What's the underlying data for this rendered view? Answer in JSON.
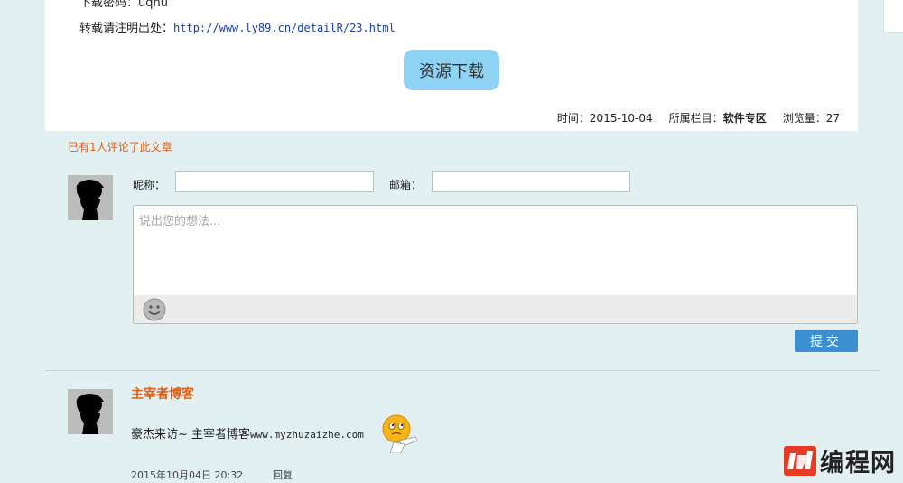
{
  "article": {
    "top_line": "下载密码：uqhu",
    "source_label": "转载请注明出处：",
    "source_url": "http://www.ly89.cn/detailR/23.html",
    "download_button": "资源下载",
    "meta": {
      "time_label": "时间：",
      "time_value": "2015-10-04",
      "category_label": "所属栏目：",
      "category_value": "软件专区",
      "views_label": "浏览量：",
      "views_value": "27"
    }
  },
  "comment_form": {
    "count_text": "已有1人评论了此文章",
    "nickname_label": "昵称：",
    "email_label": "邮箱：",
    "textarea_placeholder": "说出您的想法...",
    "submit_label": "提交"
  },
  "comments": [
    {
      "author": "主宰者博客",
      "text": "豪杰来访~ 主宰者博客",
      "url_text": "www.myzhuzaizhe.com",
      "date": "2015年10月04日 20:32",
      "reply_label": "回复"
    }
  ],
  "watermark": {
    "text": "编程网"
  },
  "colors": {
    "page_background": "#e2f0f1",
    "accent_orange": "#e0601a",
    "download_button": "#8fd3f4",
    "submit_button": "#3c8fd0",
    "link_blue": "#1a3fa6"
  },
  "icons": {
    "avatar": "silhouette-avatar-icon",
    "emoji_button": "smiley-face-icon",
    "comment_emoji": "thinking-face-icon",
    "watermark_logo": "brand-logo-icon"
  }
}
